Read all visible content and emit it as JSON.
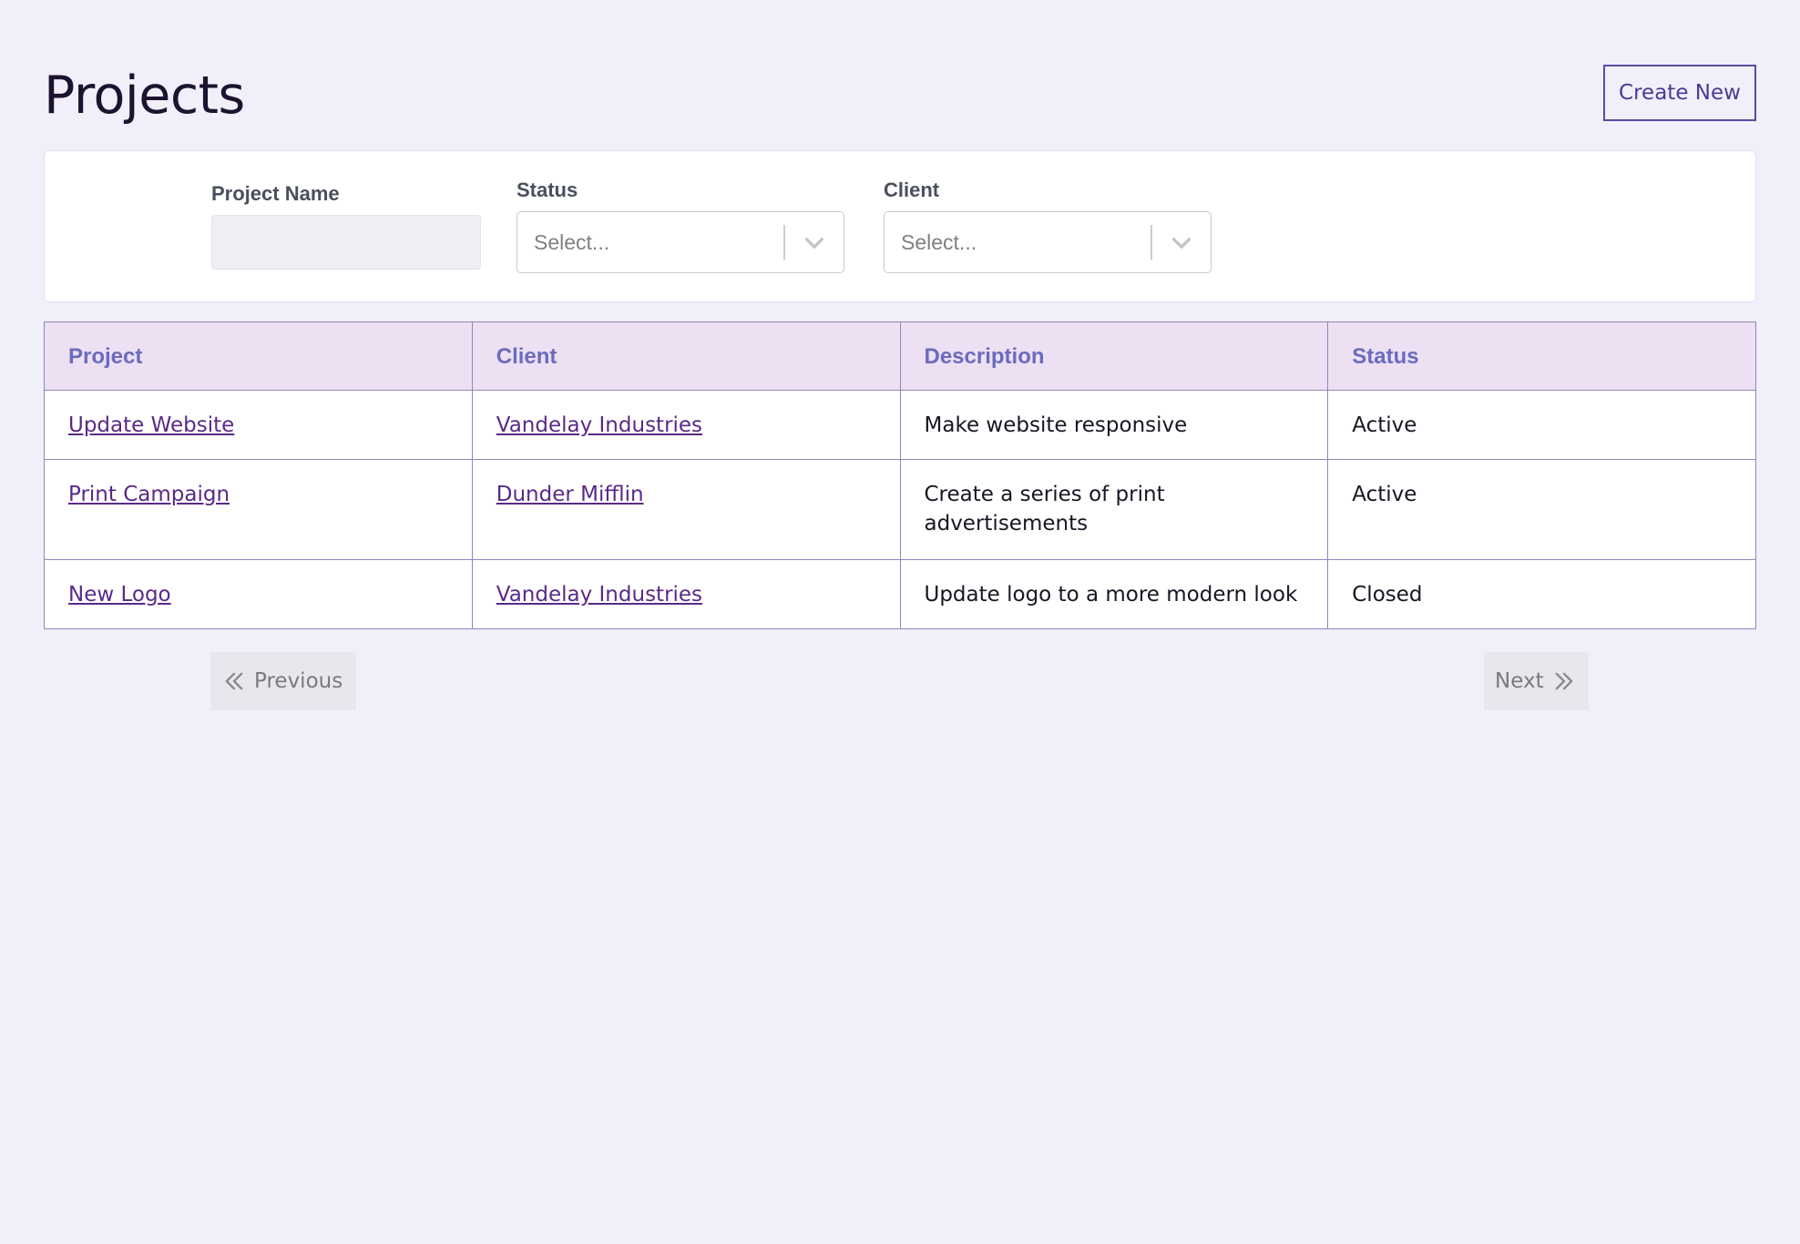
{
  "header": {
    "title": "Projects",
    "create_label": "Create New"
  },
  "filters": {
    "project_name": {
      "label": "Project Name",
      "value": ""
    },
    "status": {
      "label": "Status",
      "placeholder": "Select..."
    },
    "client": {
      "label": "Client",
      "placeholder": "Select..."
    }
  },
  "table": {
    "columns": [
      "Project",
      "Client",
      "Description",
      "Status"
    ],
    "rows": [
      {
        "project": "Update Website",
        "client": "Vandelay Industries",
        "description": "Make website responsive",
        "status": "Active"
      },
      {
        "project": "Print Campaign",
        "client": "Dunder Mifflin",
        "description": "Create a series of print advertisements",
        "status": "Active"
      },
      {
        "project": "New Logo",
        "client": "Vandelay Industries",
        "description": "Update logo to a more modern look",
        "status": "Closed"
      }
    ]
  },
  "pagination": {
    "previous_label": "Previous",
    "next_label": "Next"
  },
  "colors": {
    "background": "#f1eff9",
    "accent": "#5b4aa0",
    "header_row": "#ede0f2",
    "link": "#5a2a86"
  },
  "icons": {
    "select_chevron": "chevron-down-icon",
    "previous": "double-chevron-left-icon",
    "next": "double-chevron-right-icon"
  }
}
